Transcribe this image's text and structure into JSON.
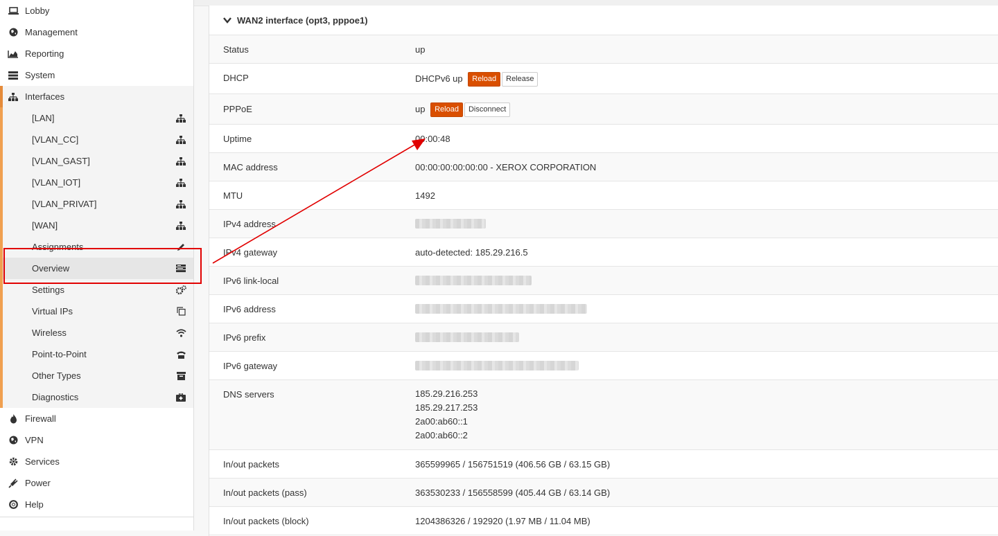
{
  "sidebar": {
    "top": [
      {
        "label": "Lobby",
        "icon": "laptop-icon"
      },
      {
        "label": "Management",
        "icon": "globe-icon"
      },
      {
        "label": "Reporting",
        "icon": "area-chart-icon"
      },
      {
        "label": "System",
        "icon": "server-icon"
      },
      {
        "label": "Interfaces",
        "icon": "sitemap-icon"
      }
    ],
    "interfaces_sub": [
      {
        "label": "[LAN]",
        "icon": "sitemap-icon"
      },
      {
        "label": "[VLAN_CC]",
        "icon": "sitemap-icon"
      },
      {
        "label": "[VLAN_GAST]",
        "icon": "sitemap-icon"
      },
      {
        "label": "[VLAN_IOT]",
        "icon": "sitemap-icon"
      },
      {
        "label": "[VLAN_PRIVAT]",
        "icon": "sitemap-icon"
      },
      {
        "label": "[WAN]",
        "icon": "sitemap-icon"
      },
      {
        "label": "Assignments",
        "icon": "pencil-icon"
      },
      {
        "label": "Overview",
        "icon": "tasks-icon"
      },
      {
        "label": "Settings",
        "icon": "cogs-icon"
      },
      {
        "label": "Virtual IPs",
        "icon": "clone-icon"
      },
      {
        "label": "Wireless",
        "icon": "wifi-icon"
      },
      {
        "label": "Point-to-Point",
        "icon": "phone-icon"
      },
      {
        "label": "Other Types",
        "icon": "archive-icon"
      },
      {
        "label": "Diagnostics",
        "icon": "medkit-icon"
      }
    ],
    "bottom": [
      {
        "label": "Firewall",
        "icon": "fire-icon"
      },
      {
        "label": "VPN",
        "icon": "globe-icon"
      },
      {
        "label": "Services",
        "icon": "cog-icon"
      },
      {
        "label": "Power",
        "icon": "plug-icon"
      },
      {
        "label": "Help",
        "icon": "lifebuoy-icon"
      }
    ]
  },
  "panel": {
    "title": "WAN2 interface (opt3, pppoe1)",
    "rows": {
      "status": {
        "k": "Status",
        "v": "up"
      },
      "dhcp": {
        "k": "DHCP",
        "v": "DHCPv6 up",
        "reload": "Reload",
        "release": "Release"
      },
      "pppoe": {
        "k": "PPPoE",
        "v": "up",
        "reload": "Reload",
        "disconnect": "Disconnect"
      },
      "uptime": {
        "k": "Uptime",
        "v": "00:00:48"
      },
      "mac": {
        "k": "MAC address",
        "v": "00:00:00:00:00:00 - XEROX CORPORATION"
      },
      "mtu": {
        "k": "MTU",
        "v": "1492"
      },
      "ipv4": {
        "k": "IPv4 address"
      },
      "ipv4gw": {
        "k": "IPv4 gateway",
        "v": "auto-detected: 185.29.216.5"
      },
      "ipv6ll": {
        "k": "IPv6 link-local"
      },
      "ipv6": {
        "k": "IPv6 address"
      },
      "ipv6prefix": {
        "k": "IPv6 prefix"
      },
      "ipv6gw": {
        "k": "IPv6 gateway"
      },
      "dns": {
        "k": "DNS servers",
        "v": [
          "185.29.216.253",
          "185.29.217.253",
          "2a00:ab60::1",
          "2a00:ab60::2"
        ]
      },
      "pkts": {
        "k": "In/out packets",
        "v": "365599965 / 156751519 (406.56 GB / 63.15 GB)"
      },
      "pkts_pass": {
        "k": "In/out packets (pass)",
        "v": "363530233 / 156558599 (405.44 GB / 63.14 GB)"
      },
      "pkts_block": {
        "k": "In/out packets (block)",
        "v": "1204386326 / 192920 (1.97 MB / 11.04 MB)"
      }
    }
  },
  "colors": {
    "accent": "#d94f00",
    "highlight_box": "#e10000",
    "menu_bar": "#e58b3a"
  }
}
